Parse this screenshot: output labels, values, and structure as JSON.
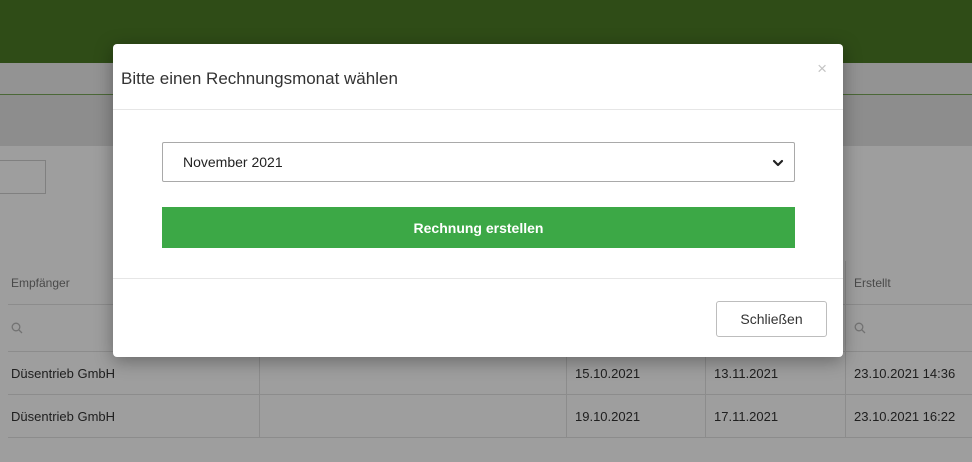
{
  "colors": {
    "topbar": "#4c7b26",
    "accent_button": "#3ca846"
  },
  "table": {
    "headers": [
      "Empfänger",
      "",
      "",
      "",
      "Erstellt"
    ],
    "rows": [
      [
        "Düsentrieb GmbH",
        "",
        "15.10.2021",
        "13.11.2021",
        "23.10.2021 14:36"
      ],
      [
        "Düsentrieb GmbH",
        "",
        "19.10.2021",
        "17.11.2021",
        "23.10.2021 16:22"
      ]
    ],
    "filter_icon": "search-icon"
  },
  "modal": {
    "title": "Bitte einen Rechnungsmonat wählen",
    "close_symbol": "×",
    "selected_month": "November 2021",
    "create_button": "Rechnung erstellen",
    "close_button": "Schließen"
  }
}
